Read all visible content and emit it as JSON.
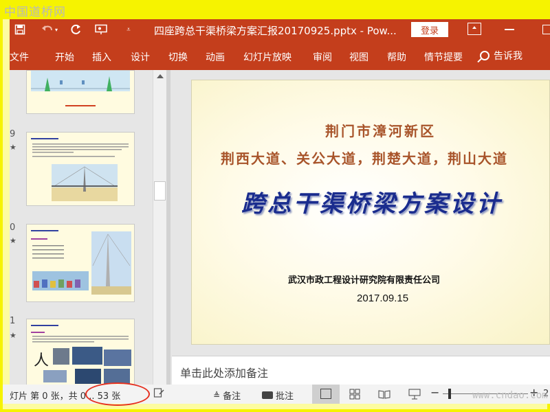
{
  "watermarks": {
    "top": "中国道桥网",
    "bottom": "www.cndao.com"
  },
  "titlebar": {
    "save_icon": "save-icon",
    "undo_icon": "undo-icon",
    "redo_icon": "redo-icon",
    "present_icon": "present-from-start-icon",
    "customize_icon": "customize-toolbar-icon",
    "document_title": "四座跨总干渠桥梁方案汇报20170925.pptx - Pow...",
    "login_label": "登录",
    "accent": "#c43e1c"
  },
  "menu": {
    "items": [
      "文件",
      "开始",
      "插入",
      "设计",
      "切换",
      "动画",
      "幻灯片放映",
      "审阅",
      "视图",
      "帮助",
      "情节提要"
    ],
    "tell_me": "告诉我"
  },
  "thumbnails": {
    "slides": [
      {
        "number": "",
        "title": ""
      },
      {
        "number": "9",
        "title": "4.3 方案一：人字塔斜拉桥"
      },
      {
        "number": "0",
        "title": "4.3 方案一：人字塔斜拉桥"
      },
      {
        "number": "1",
        "title": "4.3 方案一：人字塔斜拉桥"
      }
    ],
    "slide4_char": "人"
  },
  "slide": {
    "line1": "荆门市漳河新区",
    "line2": "荆西大道、关公大道，荆楚大道，荆山大道",
    "line3": "跨总干渠桥梁方案设计",
    "company": "武汉市政工程设计研究院有限责任公司",
    "date": "2017.09.15"
  },
  "notes": {
    "placeholder": "单击此处添加备注"
  },
  "status": {
    "slide_info": "灯片 第 0 张，共 0 .. 53 张",
    "notes_label": "备注",
    "comments_label": "批注",
    "zoom_minus": "−",
    "zoom_plus": "+",
    "zoom_value": "2"
  }
}
